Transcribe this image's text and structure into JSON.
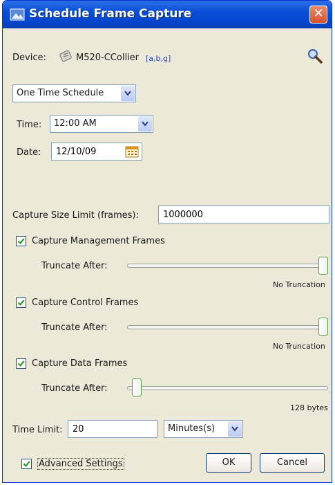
{
  "window": {
    "title": "Schedule Frame Capture",
    "close_label": "✕"
  },
  "device": {
    "label": "Device:",
    "name": "M520-CCollier",
    "bands": "[a,b,g]"
  },
  "schedule_type": {
    "value": "One Time Schedule"
  },
  "time": {
    "label": "Time:",
    "value": "12:00 AM"
  },
  "date": {
    "label": "Date:",
    "value": "12/10/09"
  },
  "capture_size": {
    "label": "Capture Size Limit (frames):",
    "value": "1000000"
  },
  "frame_groups": [
    {
      "checkbox_label": "Capture Management Frames",
      "checked": true,
      "truncate_label": "Truncate After:",
      "truncate_value": "No Truncation",
      "slider_fraction": 1.0
    },
    {
      "checkbox_label": "Capture Control Frames",
      "checked": true,
      "truncate_label": "Truncate After:",
      "truncate_value": "No Truncation",
      "slider_fraction": 1.0
    },
    {
      "checkbox_label": "Capture Data Frames",
      "checked": true,
      "truncate_label": "Truncate After:",
      "truncate_value": "128 bytes",
      "slider_fraction": 0.0
    }
  ],
  "time_limit": {
    "label": "Time Limit:",
    "value": "20",
    "unit": "Minutes(s)"
  },
  "advanced": {
    "label": "Advanced Settings",
    "checked": true
  },
  "buttons": {
    "ok": "OK",
    "cancel": "Cancel"
  },
  "icons": {
    "title": "capture-window-icon",
    "device": "wireless-device-icon",
    "search": "magnifier-icon",
    "calendar": "calendar-icon"
  }
}
